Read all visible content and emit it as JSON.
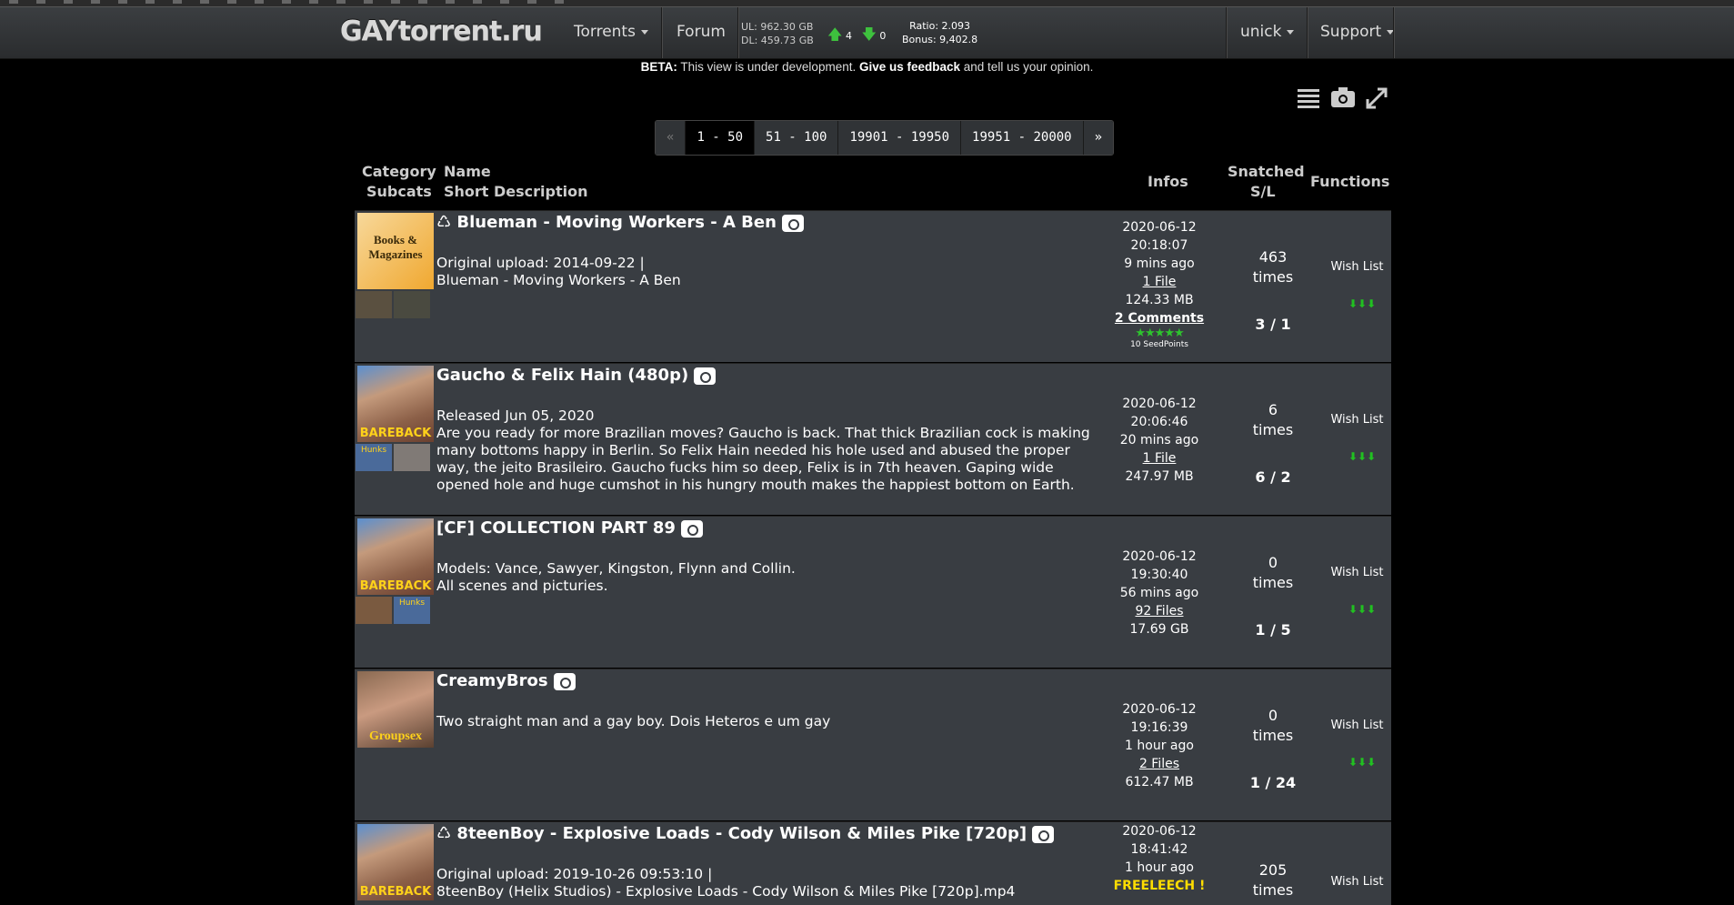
{
  "nav": {
    "logo": "GAYtorrent.ru",
    "torrents": "Torrents",
    "forum": "Forum",
    "ul": "UL: 962.30 GB",
    "dl": "DL: 459.73 GB",
    "up_count": "4",
    "down_count": "0",
    "ratio": "Ratio: 2.093",
    "bonus": "Bonus: 9,402.8",
    "user": "unick",
    "support": "Support"
  },
  "beta": {
    "prefix": "BETA:",
    "text1": " This view is under development. ",
    "link": "Give us feedback",
    "text2": " and tell us your opinion."
  },
  "pager": [
    "«",
    "1 - 50",
    "51 - 100",
    "19901 - 19950",
    "19951 - 20000",
    "»"
  ],
  "columns": {
    "category": "Category",
    "subcats": "Subcats",
    "name": "Name",
    "short_desc": "Short Description",
    "infos": "Infos",
    "snatched": "Snatched",
    "sl": "S/L",
    "functions": "Functions"
  },
  "rows": [
    {
      "title": "Blueman - Moving Workers - A Ben",
      "recycle": "♺",
      "desc1": "Original upload: 2014-09-22 |",
      "desc2": "Blueman - Moving Workers - A Ben",
      "date": "2020-06-12",
      "time": "20:18:07",
      "ago": "9 mins ago",
      "files": "1 File",
      "size": "124.33 MB",
      "comments": "2 Comments",
      "stars": "★★★★★",
      "seedpoints": "10 SeedPoints",
      "snatched": "463",
      "times": "times",
      "sl": "3 / 1",
      "wish": "Wish List",
      "category": "Books & Magazines"
    },
    {
      "title": "Gaucho & Felix Hain (480p)",
      "desc1": "Released Jun 05, 2020",
      "desc2": "Are you ready for more Brazilian moves? Gaucho is back. That thick Brazilian cock is making many bottoms happy in Berlin. So Felix Hain needed his hole used and abused the proper way, the jeito Brasileiro. Gaucho fucks him so deep, Felix is in 7th heaven. Gaping wide opened hole and huge cumshot in his hungry mouth makes the happiest bottom on Earth.",
      "date": "2020-06-12",
      "time": "20:06:46",
      "ago": "20 mins ago",
      "files": "1 File",
      "size": "247.97 MB",
      "snatched": "6",
      "times": "times",
      "sl": "6 / 2",
      "wish": "Wish List",
      "category": "BAREBACK",
      "subcat1": "Hunks"
    },
    {
      "title": "[CF] COLLECTION PART 89",
      "desc1": "Models: Vance, Sawyer, Kingston, Flynn and Collin.",
      "desc2": "All scenes and picturies.",
      "date": "2020-06-12",
      "time": "19:30:40",
      "ago": "56 mins ago",
      "files": "92 Files",
      "size": "17.69 GB",
      "snatched": "0",
      "times": "times",
      "sl": "1 / 5",
      "wish": "Wish List",
      "category": "BAREBACK",
      "subcat2": "Hunks"
    },
    {
      "title": "CreamyBros",
      "desc1": "",
      "desc2": "Two straight man and a gay boy. Dois Heteros e um gay",
      "date": "2020-06-12",
      "time": "19:16:39",
      "ago": "1 hour ago",
      "files": "2 Files",
      "size": "612.47 MB",
      "snatched": "0",
      "times": "times",
      "sl": "1 / 24",
      "wish": "Wish List",
      "category": "Groupsex"
    },
    {
      "title": "8teenBoy - Explosive Loads - Cody Wilson & Miles Pike [720p]",
      "recycle": "♺",
      "desc1": "Original upload: 2019-10-26 09:53:10 |",
      "desc2": "8teenBoy (Helix Studios) - Explosive Loads - Cody Wilson & Miles Pike [720p].mp4",
      "date": "2020-06-12",
      "time": "18:41:42",
      "ago": "1 hour ago",
      "freeleech": "FREELEECH !",
      "snatched": "205",
      "times": "times",
      "wish": "Wish List",
      "category": "BAREBACK"
    }
  ],
  "icons": [
    "list-icon",
    "camera-icon",
    "expand-icon",
    "recycle-icon",
    "download-icon",
    "star-icon",
    "caret-down-icon",
    "arrow-up-icon",
    "arrow-down-icon"
  ]
}
